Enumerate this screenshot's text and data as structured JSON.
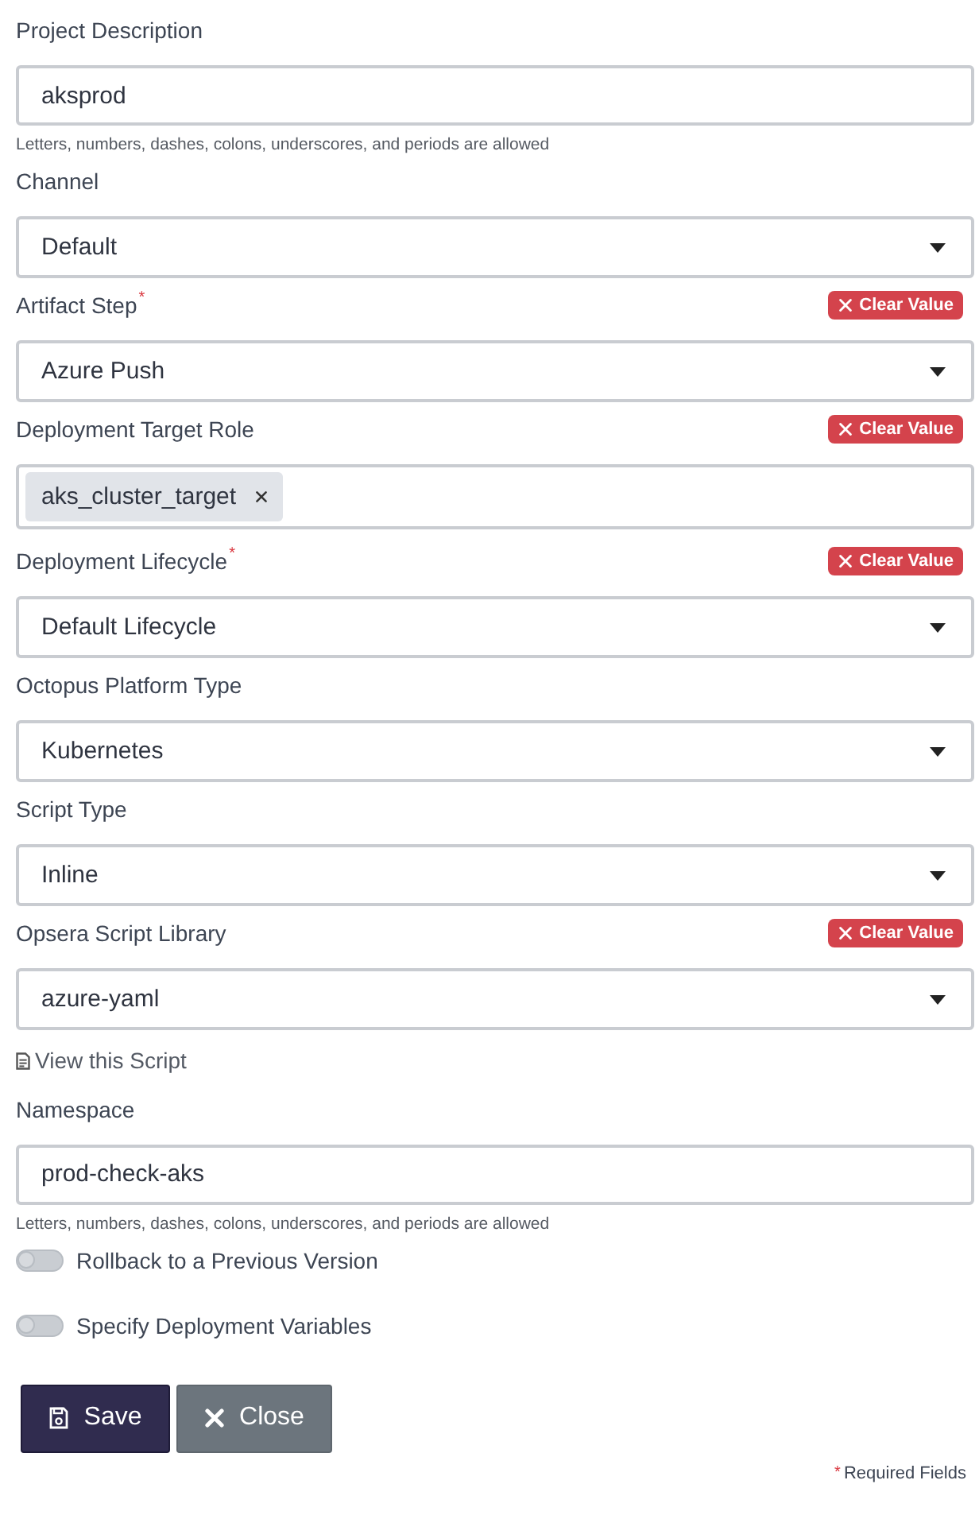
{
  "fields": [
    {
      "kind": "text",
      "label": "Project Description",
      "value": "aksprod",
      "help": "Letters, numbers, dashes, colons, underscores, and periods are allowed"
    },
    {
      "kind": "select",
      "label": "Channel",
      "value": "Default"
    },
    {
      "kind": "select",
      "label": "Artifact Step$^{*}$",
      "clear_label": "Clear Value",
      "value": "Azure Push"
    },
    {
      "kind": "multi",
      "label": "Deployment Target Role",
      "clear_label": "Clear Value",
      "tags": [
        "aks_cluster_target"
      ]
    },
    {
      "kind": "select",
      "label": "Deployment Lifecycle$^{*}$",
      "clear_label": "Clear Value",
      "value": "Default Lifecycle"
    },
    {
      "kind": "select",
      "label": "Octopus Platform Type",
      "value": "Kubernetes"
    },
    {
      "kind": "select",
      "label": "Script Type",
      "value": "Inline"
    },
    {
      "kind": "select",
      "label": "Opsera Script Library",
      "clear_label": "Clear Value",
      "value": "azure-yaml"
    },
    {
      "kind": "link",
      "label": "View this Script"
    },
    {
      "kind": "text",
      "label": "Namespace",
      "value": "prod-check-aks",
      "help": "Letters, numbers, dashes, colons, underscores, and periods are allowed"
    },
    {
      "kind": "toggle",
      "label": "Rollback to a Previous Version",
      "on": false
    },
    {
      "kind": "toggle",
      "label": "Specify Deployment Variables",
      "on": false
    }
  ],
  "buttons": [
    {
      "kind": "save",
      "label": "Save"
    },
    {
      "kind": "close",
      "label": "Close"
    }
  ],
  "required_note": "$^{*}$Required Fields"
}
